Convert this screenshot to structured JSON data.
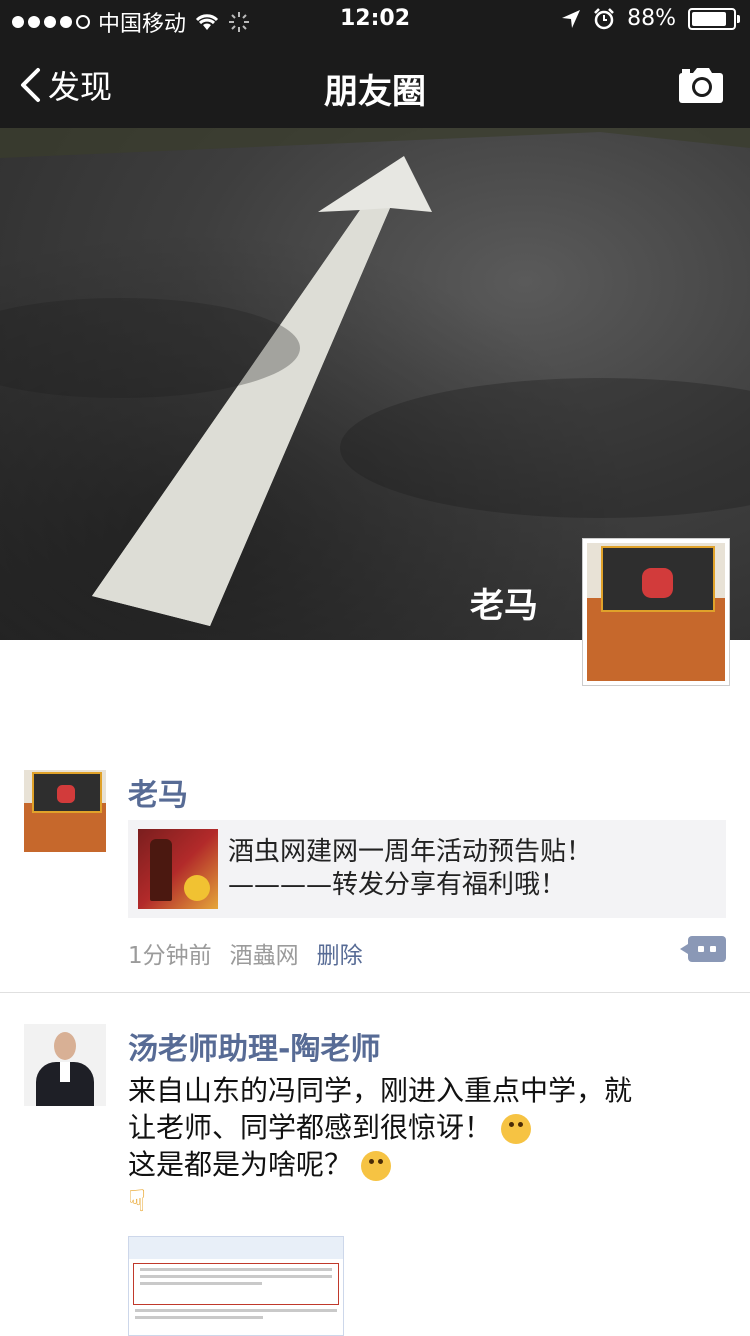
{
  "status_bar": {
    "carrier": "中国移动",
    "time": "12:02",
    "battery": "88%"
  },
  "nav": {
    "back_label": "发现",
    "title": "朋友圈"
  },
  "cover": {
    "user_name": "老马"
  },
  "posts": [
    {
      "author": "老马",
      "share_title_line1": "酒虫网建网一周年活动预告贴！",
      "share_title_line2": "————转发分享有福利哦！",
      "time": "1分钟前",
      "source": "酒蟲网",
      "delete_label": "删除"
    },
    {
      "author": "汤老师助理-陶老师",
      "text_line1": "来自山东的冯同学，刚进入重点中学，就",
      "text_line2": "让老师、同学都感到很惊讶！",
      "text_line3": "这是都是为啥呢？"
    }
  ]
}
